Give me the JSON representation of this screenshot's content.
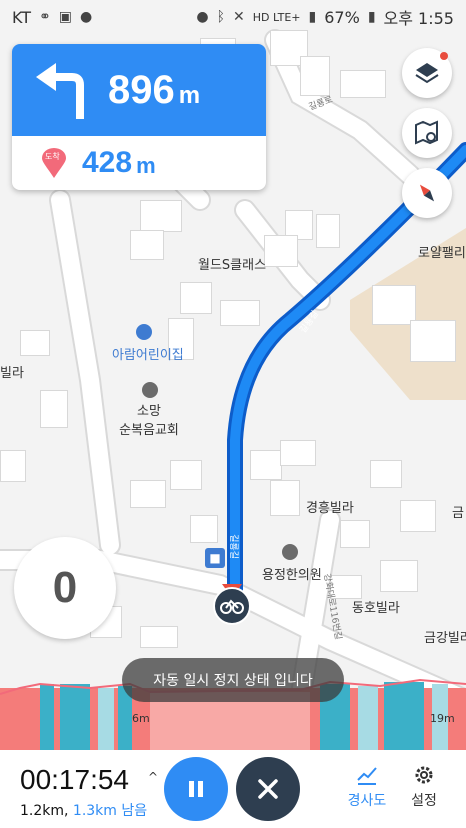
{
  "status_bar": {
    "carrier": "KT",
    "network": "HD LTE+",
    "battery": "67%",
    "time": "오후 1:55"
  },
  "navigation": {
    "turn_distance": "896",
    "turn_unit": "m",
    "destination_badge": "도착",
    "destination_distance": "428",
    "destination_unit": "m"
  },
  "map": {
    "labels": {
      "world_class": "월드S클래스",
      "kindergarten": "아람어린이집",
      "church_line1": "소망",
      "church_line2": "순복음교회",
      "royal_palace": "로얄팰리",
      "gyeongheung": "경흥빌라",
      "yongjeong_clinic": "용정한의원",
      "donghwa": "동호빌라",
      "geumgang": "금강빌라",
      "geum_partial": "금",
      "villa_left": "빌라",
      "road_top": "길룡로",
      "road_mid": "길룡길",
      "road_vertical1": "강화대로",
      "road_vertical2": "강화대로116번길",
      "road_small": "길룡길"
    }
  },
  "speed": "0",
  "toast": "자동 일시 정지 상태 입니다",
  "elevation": {
    "label_left": "6m",
    "label_right": "19m"
  },
  "bottom_bar": {
    "elapsed": "00:17:54",
    "distance_done": "1.2km, ",
    "distance_remaining": "1.3km 남음",
    "tab_slope": "경사도",
    "tab_settings": "설정"
  },
  "colors": {
    "accent": "#2f8cf4",
    "route": "#1e78f0",
    "close_button": "#2e3e50"
  }
}
